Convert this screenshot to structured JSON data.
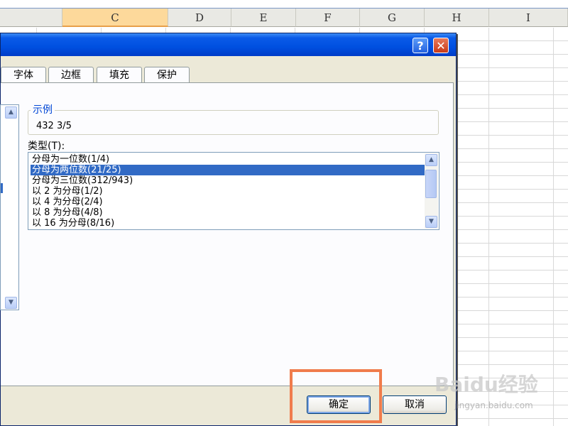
{
  "spreadsheet": {
    "columns": [
      "C",
      "D",
      "E",
      "F",
      "G",
      "H",
      "I"
    ],
    "selected_column": "C"
  },
  "dialog": {
    "help_label": "?",
    "close_label": "✕",
    "tabs": [
      "字体",
      "边框",
      "填充",
      "保护"
    ],
    "sample_group_label": "示例",
    "sample_value": "432  3/5",
    "type_label": "类型(T):",
    "type_items": [
      "分母为一位数(1/4)",
      "分母为两位数(21/25)",
      "分母为三位数(312/943)",
      "以 2 为分母(1/2)",
      "以 4 为分母(2/4)",
      "以 8 为分母(4/8)",
      "以 16 为分母(8/16)"
    ],
    "selected_type_index": 1,
    "ok_label": "确定",
    "cancel_label": "取消"
  },
  "overlay": {
    "highlight_color": "#f07c4c",
    "watermark": "Baidu经验",
    "watermark_sub": "jingyan.baidu.com"
  }
}
